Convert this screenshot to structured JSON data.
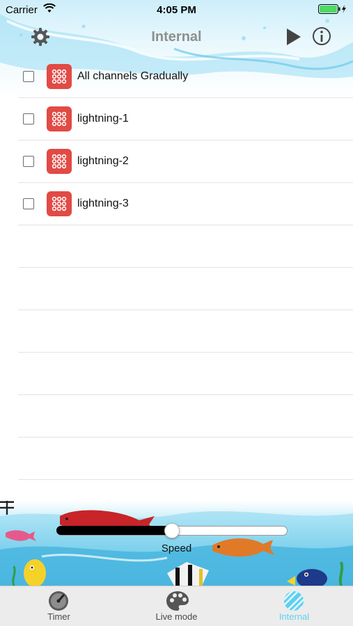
{
  "status_bar": {
    "carrier": "Carrier",
    "time": "4:05 PM"
  },
  "nav": {
    "title": "Internal",
    "left_icon": "gear-icon",
    "right_icons": [
      "play-icon",
      "info-icon"
    ]
  },
  "list": {
    "items": [
      {
        "label": "All channels Gradually",
        "checked": false,
        "icon": "dots-grid-icon"
      },
      {
        "label": "lightning-1",
        "checked": false,
        "icon": "dots-grid-icon"
      },
      {
        "label": "lightning-2",
        "checked": false,
        "icon": "dots-grid-icon"
      },
      {
        "label": "lightning-3",
        "checked": false,
        "icon": "dots-grid-icon"
      }
    ]
  },
  "speed_control": {
    "label": "Speed",
    "minus_icon": "minus-icon",
    "plus_icon": "plus-icon",
    "value_fraction": 0.5
  },
  "tabbar": {
    "tabs": [
      {
        "label": "Timer",
        "icon": "gauge-icon",
        "active": false
      },
      {
        "label": "Live mode",
        "icon": "palette-icon",
        "active": false
      },
      {
        "label": "Internal",
        "icon": "striped-circle-icon",
        "active": true
      }
    ]
  },
  "colors": {
    "accent": "#5ed0f2",
    "item_icon": "#e24a45",
    "title_gray": "#8f8f8f",
    "tab_inactive": "#4a4a4a"
  }
}
